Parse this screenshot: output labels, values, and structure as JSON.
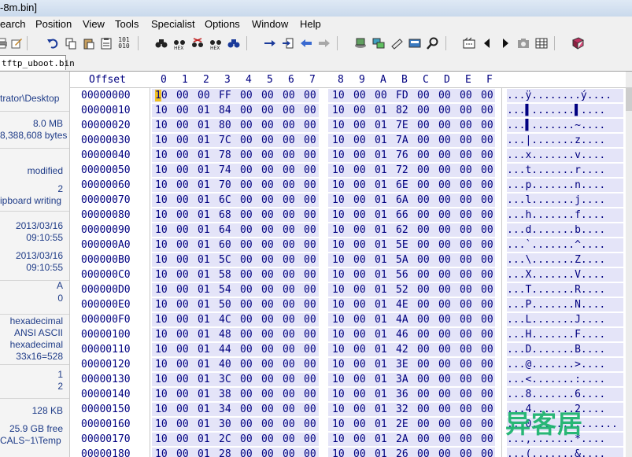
{
  "window": {
    "title": "-8m.bin]"
  },
  "menu": [
    "earch",
    "Position",
    "View",
    "Tools",
    "Specialist",
    "Options",
    "Window",
    "Help"
  ],
  "toolbar_icons": [
    "print-icon",
    "edit-icon",
    "undo-icon",
    "copy-icon",
    "paste-icon",
    "clipboard-icon",
    "hex-convert-icon",
    "find-icon",
    "find-hex-icon",
    "replace-icon",
    "replace-hex-icon",
    "find-again-icon",
    "goto-offset-icon",
    "goto-sector-icon",
    "back-icon",
    "forward-icon",
    "disk-icon",
    "ram-icon",
    "hand-icon",
    "calculator-icon",
    "search-icon",
    "film-icon",
    "prev-icon",
    "next-icon",
    "camera-icon",
    "grid-icon",
    "book-icon"
  ],
  "tab": {
    "label": "tftp_uboot.bin"
  },
  "info": {
    "path": "trator\\Desktop",
    "file_size": "8.0 MB",
    "file_bytes": "8,388,608 bytes",
    "state": "modified",
    "undo_level": "2",
    "undo_reverses": "ipboard writing",
    "created_date": "2013/03/16",
    "created_time": "09:10:55",
    "modified_date": "2013/03/16",
    "modified_time": "09:10:55",
    "attr": "A",
    "icons": "0",
    "mode": "hexadecimal",
    "charset": "ANSI ASCII",
    "offsets": "hexadecimal",
    "bytes_per_page": "33x16=528",
    "windows_num": "1",
    "windows_count": "2",
    "clipboard": "128 KB",
    "free_space": "25.9 GB free",
    "temp_folder": "CALS~1\\Temp"
  },
  "hex": {
    "offset_header": "Offset",
    "columns": [
      "0",
      "1",
      "2",
      "3",
      "4",
      "5",
      "6",
      "7",
      "8",
      "9",
      "A",
      "B",
      "C",
      "D",
      "E",
      "F"
    ],
    "rows": [
      {
        "offset": "00000000",
        "bytes": [
          "10",
          "00",
          "00",
          "FF",
          "00",
          "00",
          "00",
          "00",
          "10",
          "00",
          "00",
          "FD",
          "00",
          "00",
          "00",
          "00"
        ],
        "text": "...ÿ........ý...."
      },
      {
        "offset": "00000010",
        "bytes": [
          "10",
          "00",
          "01",
          "84",
          "00",
          "00",
          "00",
          "00",
          "10",
          "00",
          "01",
          "82",
          "00",
          "00",
          "00",
          "00"
        ],
        "text": "...▌.......▌...."
      },
      {
        "offset": "00000020",
        "bytes": [
          "10",
          "00",
          "01",
          "80",
          "00",
          "00",
          "00",
          "00",
          "10",
          "00",
          "01",
          "7E",
          "00",
          "00",
          "00",
          "00"
        ],
        "text": "...▌.......~...."
      },
      {
        "offset": "00000030",
        "bytes": [
          "10",
          "00",
          "01",
          "7C",
          "00",
          "00",
          "00",
          "00",
          "10",
          "00",
          "01",
          "7A",
          "00",
          "00",
          "00",
          "00"
        ],
        "text": "...|.......z...."
      },
      {
        "offset": "00000040",
        "bytes": [
          "10",
          "00",
          "01",
          "78",
          "00",
          "00",
          "00",
          "00",
          "10",
          "00",
          "01",
          "76",
          "00",
          "00",
          "00",
          "00"
        ],
        "text": "...x.......v...."
      },
      {
        "offset": "00000050",
        "bytes": [
          "10",
          "00",
          "01",
          "74",
          "00",
          "00",
          "00",
          "00",
          "10",
          "00",
          "01",
          "72",
          "00",
          "00",
          "00",
          "00"
        ],
        "text": "...t.......r...."
      },
      {
        "offset": "00000060",
        "bytes": [
          "10",
          "00",
          "01",
          "70",
          "00",
          "00",
          "00",
          "00",
          "10",
          "00",
          "01",
          "6E",
          "00",
          "00",
          "00",
          "00"
        ],
        "text": "...p.......n...."
      },
      {
        "offset": "00000070",
        "bytes": [
          "10",
          "00",
          "01",
          "6C",
          "00",
          "00",
          "00",
          "00",
          "10",
          "00",
          "01",
          "6A",
          "00",
          "00",
          "00",
          "00"
        ],
        "text": "...l.......j...."
      },
      {
        "offset": "00000080",
        "bytes": [
          "10",
          "00",
          "01",
          "68",
          "00",
          "00",
          "00",
          "00",
          "10",
          "00",
          "01",
          "66",
          "00",
          "00",
          "00",
          "00"
        ],
        "text": "...h.......f...."
      },
      {
        "offset": "00000090",
        "bytes": [
          "10",
          "00",
          "01",
          "64",
          "00",
          "00",
          "00",
          "00",
          "10",
          "00",
          "01",
          "62",
          "00",
          "00",
          "00",
          "00"
        ],
        "text": "...d.......b...."
      },
      {
        "offset": "000000A0",
        "bytes": [
          "10",
          "00",
          "01",
          "60",
          "00",
          "00",
          "00",
          "00",
          "10",
          "00",
          "01",
          "5E",
          "00",
          "00",
          "00",
          "00"
        ],
        "text": "...`.......^...."
      },
      {
        "offset": "000000B0",
        "bytes": [
          "10",
          "00",
          "01",
          "5C",
          "00",
          "00",
          "00",
          "00",
          "10",
          "00",
          "01",
          "5A",
          "00",
          "00",
          "00",
          "00"
        ],
        "text": "...\\.......Z...."
      },
      {
        "offset": "000000C0",
        "bytes": [
          "10",
          "00",
          "01",
          "58",
          "00",
          "00",
          "00",
          "00",
          "10",
          "00",
          "01",
          "56",
          "00",
          "00",
          "00",
          "00"
        ],
        "text": "...X.......V...."
      },
      {
        "offset": "000000D0",
        "bytes": [
          "10",
          "00",
          "01",
          "54",
          "00",
          "00",
          "00",
          "00",
          "10",
          "00",
          "01",
          "52",
          "00",
          "00",
          "00",
          "00"
        ],
        "text": "...T.......R...."
      },
      {
        "offset": "000000E0",
        "bytes": [
          "10",
          "00",
          "01",
          "50",
          "00",
          "00",
          "00",
          "00",
          "10",
          "00",
          "01",
          "4E",
          "00",
          "00",
          "00",
          "00"
        ],
        "text": "...P.......N...."
      },
      {
        "offset": "000000F0",
        "bytes": [
          "10",
          "00",
          "01",
          "4C",
          "00",
          "00",
          "00",
          "00",
          "10",
          "00",
          "01",
          "4A",
          "00",
          "00",
          "00",
          "00"
        ],
        "text": "...L.......J...."
      },
      {
        "offset": "00000100",
        "bytes": [
          "10",
          "00",
          "01",
          "48",
          "00",
          "00",
          "00",
          "00",
          "10",
          "00",
          "01",
          "46",
          "00",
          "00",
          "00",
          "00"
        ],
        "text": "...H.......F...."
      },
      {
        "offset": "00000110",
        "bytes": [
          "10",
          "00",
          "01",
          "44",
          "00",
          "00",
          "00",
          "00",
          "10",
          "00",
          "01",
          "42",
          "00",
          "00",
          "00",
          "00"
        ],
        "text": "...D.......B...."
      },
      {
        "offset": "00000120",
        "bytes": [
          "10",
          "00",
          "01",
          "40",
          "00",
          "00",
          "00",
          "00",
          "10",
          "00",
          "01",
          "3E",
          "00",
          "00",
          "00",
          "00"
        ],
        "text": "...@.......>...."
      },
      {
        "offset": "00000130",
        "bytes": [
          "10",
          "00",
          "01",
          "3C",
          "00",
          "00",
          "00",
          "00",
          "10",
          "00",
          "01",
          "3A",
          "00",
          "00",
          "00",
          "00"
        ],
        "text": "...<.......:...."
      },
      {
        "offset": "00000140",
        "bytes": [
          "10",
          "00",
          "01",
          "38",
          "00",
          "00",
          "00",
          "00",
          "10",
          "00",
          "01",
          "36",
          "00",
          "00",
          "00",
          "00"
        ],
        "text": "...8.......6...."
      },
      {
        "offset": "00000150",
        "bytes": [
          "10",
          "00",
          "01",
          "34",
          "00",
          "00",
          "00",
          "00",
          "10",
          "00",
          "01",
          "32",
          "00",
          "00",
          "00",
          "00"
        ],
        "text": "...4.......2...."
      },
      {
        "offset": "00000160",
        "bytes": [
          "10",
          "00",
          "01",
          "30",
          "00",
          "00",
          "00",
          "00",
          "10",
          "00",
          "01",
          "2E",
          "00",
          "00",
          "00",
          "00"
        ],
        "text": "...0.............."
      },
      {
        "offset": "00000170",
        "bytes": [
          "10",
          "00",
          "01",
          "2C",
          "00",
          "00",
          "00",
          "00",
          "10",
          "00",
          "01",
          "2A",
          "00",
          "00",
          "00",
          "00"
        ],
        "text": "...,.......*...."
      },
      {
        "offset": "00000180",
        "bytes": [
          "10",
          "00",
          "01",
          "28",
          "00",
          "00",
          "00",
          "00",
          "10",
          "00",
          "01",
          "26",
          "00",
          "00",
          "00",
          "00"
        ],
        "text": "...(.......&...."
      }
    ]
  },
  "watermark": "异客居",
  "colors": {
    "hex_text": "#000080",
    "band": "#e4e4f8",
    "cursor": "#f0c020",
    "info_text": "#1f3c88",
    "watermark": "#19b36b"
  }
}
